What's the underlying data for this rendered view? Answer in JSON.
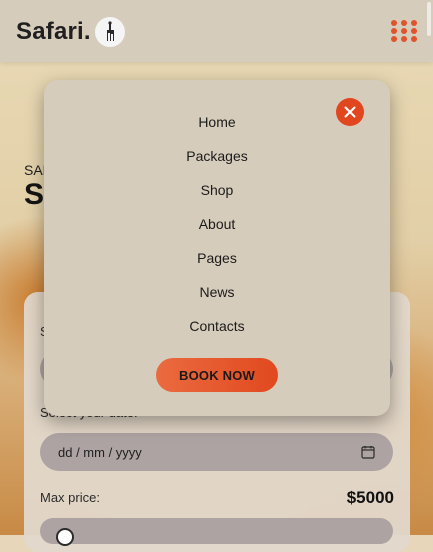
{
  "brand": {
    "name": "Safari."
  },
  "header": {
    "menu_icon": "grid-dots-icon",
    "accent": "#e1542b"
  },
  "hero": {
    "kicker": "SAFARI",
    "title": "S"
  },
  "form": {
    "label_top": "S",
    "date_label": "Select your date:",
    "date_placeholder": "dd / mm / yyyy",
    "max_price_label": "Max price:",
    "max_price_value": "$5000"
  },
  "menu": {
    "items": [
      {
        "label": "Home"
      },
      {
        "label": "Packages"
      },
      {
        "label": "Shop"
      },
      {
        "label": "About"
      },
      {
        "label": "Pages"
      },
      {
        "label": "News"
      },
      {
        "label": "Contacts"
      }
    ],
    "book_label": "BOOK NOW",
    "close_icon": "close-icon",
    "accent": "#e1461f"
  }
}
